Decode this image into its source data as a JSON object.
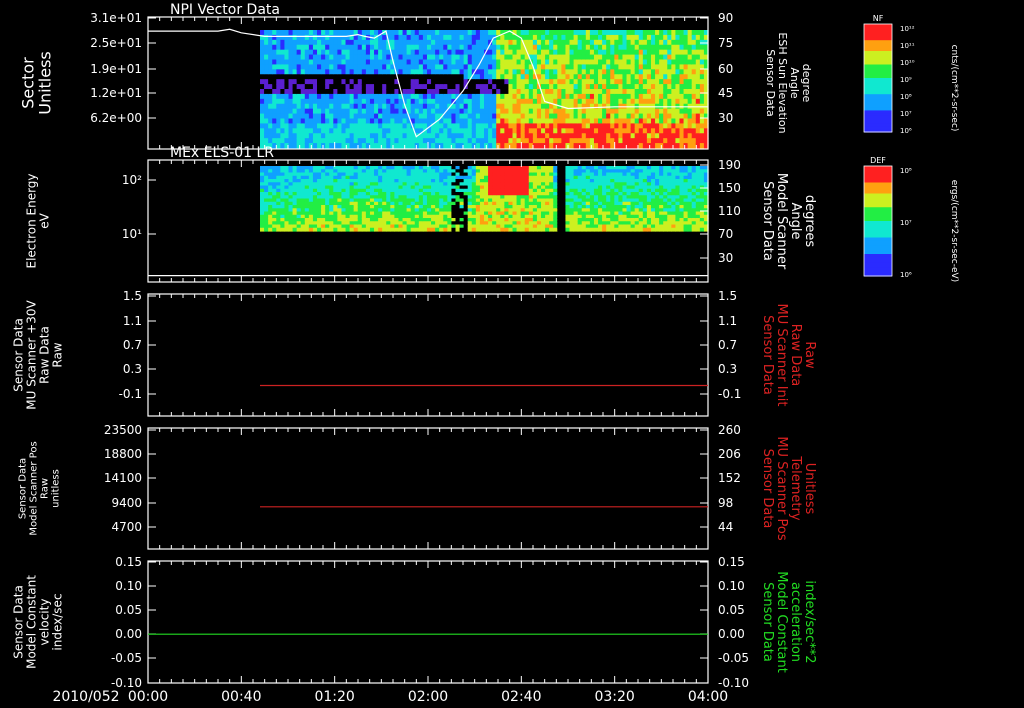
{
  "date_label": "2010/052",
  "time_ticks": [
    "00:00",
    "00:40",
    "01:20",
    "02:00",
    "02:40",
    "03:20",
    "04:00"
  ],
  "panels": [
    {
      "title": "NPI Vector Data",
      "left_label": [
        "Sector",
        "Unitless"
      ],
      "left_ticks": [
        "3.1e+01",
        "2.5e+01",
        "1.9e+01",
        "1.2e+01",
        "6.2e+00"
      ],
      "right_label": [
        "Sensor Data",
        "ESH Sun Elevation",
        "Angle",
        "degree"
      ],
      "right_ticks": [
        "90",
        "75",
        "60",
        "45",
        "30"
      ]
    },
    {
      "title": "MEx ELS-01 LR",
      "left_label": [
        "Electron Energy",
        "eV"
      ],
      "left_ticks": [
        "10²",
        "10¹"
      ],
      "right_label": [
        "Sensor Data",
        "Model Scanner",
        "Angle",
        "degrees"
      ],
      "right_ticks": [
        "190",
        "150",
        "110",
        "70",
        "30"
      ]
    },
    {
      "title": "",
      "left_label": [
        "Sensor Data",
        "MU Scanner +30V",
        "Raw Data",
        "Raw"
      ],
      "left_ticks": [
        "1.5",
        "1.1",
        "0.7",
        "0.3",
        "-0.1"
      ],
      "right_label": [
        "Sensor Data",
        "MU Scanner Init",
        "Raw Data",
        "Raw"
      ],
      "right_ticks": [
        "1.5",
        "1.1",
        "0.7",
        "0.3",
        "-0.1"
      ]
    },
    {
      "title": "",
      "left_label": [
        "Sensor Data",
        "Model Scanner Pos",
        "Raw",
        "unitless"
      ],
      "left_ticks": [
        "23500",
        "18800",
        "14100",
        "9400",
        "4700"
      ],
      "right_label": [
        "Sensor Data",
        "MU Scanner Pos",
        "Telemetry",
        "Unitless"
      ],
      "right_ticks": [
        "260",
        "206",
        "152",
        "98",
        "44"
      ]
    },
    {
      "title": "",
      "left_label": [
        "Sensor Data",
        "Model Constant",
        "velocity",
        "index/sec"
      ],
      "left_ticks": [
        "0.15",
        "0.10",
        "0.05",
        "0.00",
        "-0.05",
        "-0.10"
      ],
      "right_label": [
        "Sensor Data",
        "Model Constant",
        "acceleration",
        "index/sec**2"
      ],
      "right_ticks": [
        "0.15",
        "0.10",
        "0.05",
        "0.00",
        "-0.05",
        "-0.10"
      ]
    }
  ],
  "colorbars": [
    {
      "title": "NF",
      "ticks": [
        "10¹²",
        "10¹¹",
        "10¹⁰",
        "10⁹",
        "10⁸",
        "10⁷",
        "10⁶"
      ],
      "label": "cnts/(cm**2-sr-sec)"
    },
    {
      "title": "DEF",
      "ticks": [
        "10⁸",
        "10⁷",
        "10⁶"
      ],
      "label": "ergs/(cm**2-sr-sec-eV)"
    }
  ],
  "colors": {
    "background": "#000000",
    "axes": "#ffffff",
    "red_trace": "#cc2222",
    "green_trace": "#22dd22"
  },
  "chart_data": {
    "type": "line",
    "x_unit": "UT time",
    "x_range": [
      "00:00",
      "04:00"
    ],
    "series": [
      {
        "panel": 1,
        "axis": "right",
        "x_minutes": [
          0,
          30,
          35,
          40,
          50,
          75,
          85,
          90,
          93,
          97,
          102,
          105,
          110,
          115,
          125,
          135,
          142,
          148,
          155,
          160,
          165,
          170,
          180,
          200,
          220,
          240
        ],
        "values": [
          82,
          82,
          83,
          81,
          79,
          79,
          79,
          80,
          79,
          78,
          82,
          65,
          40,
          22,
          32,
          48,
          63,
          78,
          82,
          78,
          62,
          42,
          38,
          39,
          39,
          39
        ]
      },
      {
        "panel": 2,
        "axis": "right",
        "x_minutes": [
          0,
          240
        ],
        "values": [
          10,
          10
        ]
      },
      {
        "panel": 3,
        "axis": "left",
        "x_minutes": [
          48,
          240
        ],
        "values": [
          0.0,
          0.0
        ]
      },
      {
        "panel": 4,
        "axis": "left",
        "x_minutes": [
          48,
          240
        ],
        "values": [
          8200,
          8200
        ]
      },
      {
        "panel": 5,
        "axis": "left",
        "x_minutes": [
          0,
          240
        ],
        "values": [
          0.0,
          0.0
        ]
      }
    ]
  }
}
